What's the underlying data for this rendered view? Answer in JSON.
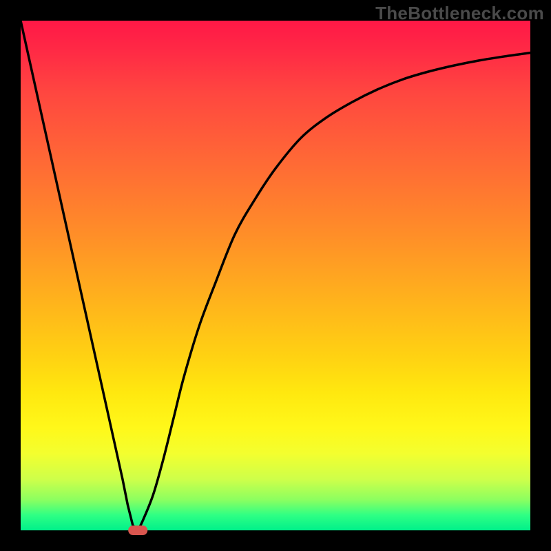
{
  "watermark": "TheBottleneck.com",
  "chart_data": {
    "type": "line",
    "title": "",
    "xlabel": "",
    "ylabel": "",
    "xlim": [
      0,
      100
    ],
    "ylim": [
      0,
      100
    ],
    "background_gradient": {
      "top": "#ff1846",
      "mid": "#ffd212",
      "bottom": "#00f08a"
    },
    "series": [
      {
        "name": "bottleneck-curve",
        "x": [
          0,
          2,
          4,
          6,
          8,
          10,
          12,
          14,
          16,
          18,
          20,
          21,
          22,
          23,
          24,
          26,
          28,
          30,
          32,
          35,
          38,
          42,
          46,
          50,
          55,
          60,
          65,
          70,
          75,
          80,
          85,
          90,
          95,
          100
        ],
        "y": [
          100,
          91,
          82,
          73,
          64,
          55,
          46,
          37,
          28,
          19,
          10,
          5,
          1,
          0,
          2,
          7,
          14,
          22,
          30,
          40,
          48,
          58,
          65,
          71,
          77,
          81,
          84,
          86.5,
          88.5,
          90,
          91.2,
          92.2,
          93,
          93.7
        ]
      }
    ],
    "marker": {
      "name": "optimum-point",
      "x": 23,
      "y": 0,
      "shape": "rounded-pill",
      "color": "#d9564f"
    },
    "notes": "V-shaped curve over vertical rainbow gradient; minimum near x≈23 at y=0; right branch asymptotically rises toward ~94."
  }
}
